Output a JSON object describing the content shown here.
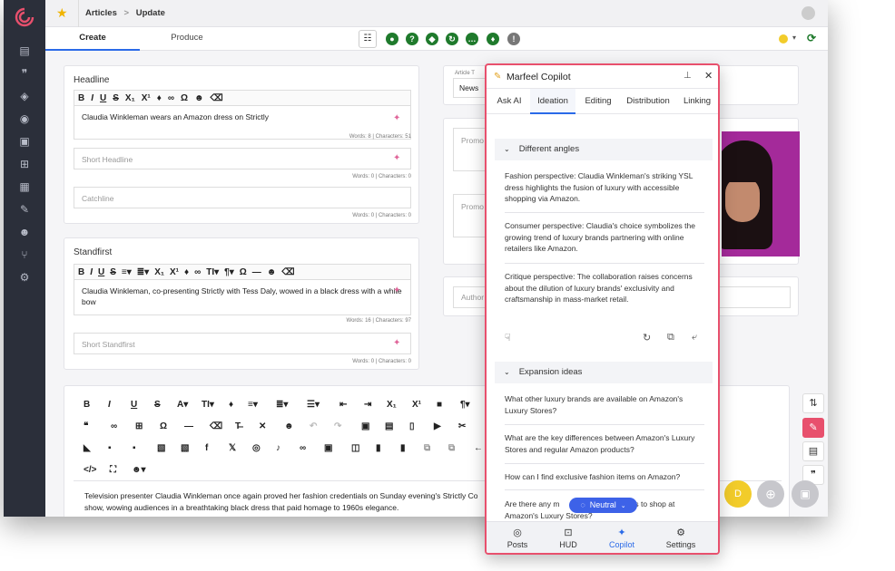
{
  "breadcrumb": {
    "first": "Articles",
    "separator": ">",
    "current": "Update"
  },
  "mode_tabs": [
    {
      "label": "Create"
    },
    {
      "label": "Produce"
    }
  ],
  "headline": {
    "label": "Headline",
    "value": "Claudia Winkleman wears an Amazon dress on Strictly",
    "counts": "Words: 8 | Characters: 51",
    "short_placeholder": "Short Headline",
    "short_counts": "Words: 0 | Characters: 0",
    "catchline_placeholder": "Catchline",
    "catchline_counts": "Words: 0 | Characters: 0"
  },
  "standfirst": {
    "label": "Standfirst",
    "value": "Claudia Winkleman, co-presenting Strictly with Tess Daly, wowed in a black dress with a white bow",
    "counts": "Words: 16 | Characters: 97",
    "short_placeholder": "Short Standfirst",
    "short_counts": "Words: 0 | Characters: 0"
  },
  "body_text": "Television presenter Claudia Winkleman once again proved her fashion credentials on Sunday evening's Strictly Co show, wowing audiences in a breathtaking black dress that paid homage to 1960s elegance.",
  "right_column": {
    "article_type_label": "Article T",
    "article_type_value": "News",
    "promo1": "Promo",
    "promo2": "Promo",
    "author": "Author"
  },
  "copilot": {
    "title": "Marfeel Copilot",
    "tabs": [
      {
        "label": "Ask AI"
      },
      {
        "label": "Ideation"
      },
      {
        "label": "Editing"
      },
      {
        "label": "Distribution"
      },
      {
        "label": "Linking"
      }
    ],
    "section1_title": "Different angles",
    "angles": [
      {
        "text": "Fashion perspective: Claudia Winkleman's striking YSL dress highlights the fusion of luxury with accessible shopping via Amazon."
      },
      {
        "text": "Consumer perspective: Claudia's choice symbolizes the growing trend of luxury brands partnering with online retailers like Amazon."
      },
      {
        "text": "Critique perspective: The collaboration raises concerns about the dilution of luxury brands' exclusivity and craftsmanship in mass-market retail."
      }
    ],
    "section2_title": "Expansion ideas",
    "ideas": [
      {
        "text": "What other luxury brands are available on Amazon's Luxury Stores?"
      },
      {
        "text": "What are the key differences between Amazon's Luxury Stores and regular Amazon products?"
      },
      {
        "text": "How can I find exclusive fashion items on Amazon?"
      },
      {
        "text": "Are there any more benefits/requirements to shop at Amazon's Luxury Stores?"
      }
    ],
    "idea4_visible_start": "Are there any m",
    "idea4_visible_end": "ments to shop at",
    "idea4_line2": "Amazon's Luxury Stores?",
    "tone_label": "Neutral",
    "footer": [
      {
        "label": "Posts"
      },
      {
        "label": "HUD"
      },
      {
        "label": "Copilot"
      },
      {
        "label": "Settings"
      }
    ]
  },
  "colors": {
    "accent": "#2a6ae8",
    "copilot_border": "#e8506d",
    "rail": "#2b2f3a",
    "green": "#1f7a2c",
    "tone_pill": "#3d62e8"
  }
}
